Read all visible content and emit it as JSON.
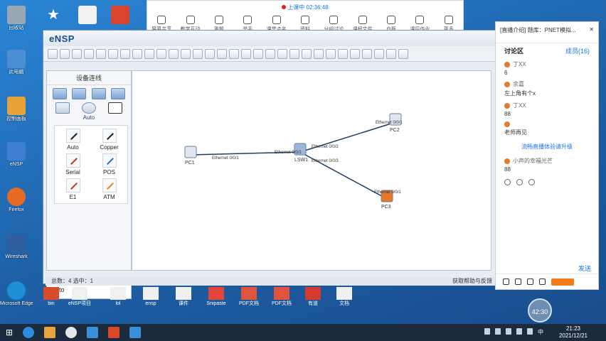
{
  "desktop": {
    "left_icons": [
      {
        "label": "回收站",
        "color": "#9aa7b5"
      },
      {
        "label": "此电脑",
        "color": "#4a8fd4"
      },
      {
        "label": "控制面板",
        "color": "#e5a33a"
      },
      {
        "label": "eNSP",
        "color": "#3e7fd1"
      },
      {
        "label": "Firefox",
        "color": "#e66b22"
      },
      {
        "label": "Wireshark",
        "color": "#2e5f9e"
      },
      {
        "label": "Microsoft Edge",
        "color": "#1e8fd6"
      }
    ],
    "bottom_icons": [
      {
        "label": "bin",
        "color": "#d94a2a"
      },
      {
        "label": "eNSP项目",
        "color": "#f0f0f0"
      },
      {
        "label": "lol",
        "color": "#f0f0f0"
      },
      {
        "label": "ensp",
        "color": "#f0f0f0"
      },
      {
        "label": "课件",
        "color": "#f0f0f0"
      },
      {
        "label": "Snipaste",
        "color": "#e2453b"
      },
      {
        "label": "PDF文档",
        "color": "#e0533c"
      },
      {
        "label": "PDF文档",
        "color": "#e0533c"
      },
      {
        "label": "有道",
        "color": "#d43a30"
      },
      {
        "label": "文档",
        "color": "#f0f0f0"
      }
    ]
  },
  "classbar": {
    "status": "上课中 02:36:48",
    "tools": [
      "屏幕共享",
      "教学互动",
      "答题",
      "举手",
      "课堂点名",
      "资料",
      "分组讨论",
      "课程文件",
      "白板",
      "课后作业",
      "更多"
    ]
  },
  "ensp": {
    "title": "eNSP",
    "sidebar_title": "设备连线",
    "selected_device": "Auto",
    "cables": [
      {
        "label": "Auto",
        "color": "#222222"
      },
      {
        "label": "Copper",
        "color": "#222222"
      },
      {
        "label": "Serial",
        "color": "#c0392b"
      },
      {
        "label": "POS",
        "color": "#2b6cd4"
      },
      {
        "label": "E1",
        "color": "#c0392b"
      },
      {
        "label": "ATM",
        "color": "#d98a1e"
      }
    ],
    "sidebar_bottom": "Auto",
    "status_left": "总数：4 选中：1",
    "status_right": "获取帮助与反馈",
    "topology": {
      "nodes": [
        {
          "id": "PC1",
          "label": "PC1"
        },
        {
          "id": "LSW1",
          "label": "LSW1"
        },
        {
          "id": "PC2",
          "label": "PC2"
        },
        {
          "id": "PC3",
          "label": "PC3"
        }
      ],
      "ports": [
        "Ethernet 0/0/1",
        "Ethernet 0/0/1",
        "Ethernet 0/0/2",
        "Ethernet 0/0/3",
        "Ethernet 0/0/1",
        "Ethernet 0/0/1"
      ]
    }
  },
  "discussion": {
    "header": "[直播介绍] 题库：PNET模拟...",
    "tab": "讨论区",
    "member_count": "成员(16)",
    "messages": [
      {
        "name": "丁XX",
        "text": "6"
      },
      {
        "name": "余嘉",
        "text": "左上角有个x"
      },
      {
        "name": "丁XX",
        "text": "88"
      },
      {
        "name": "",
        "text": "老师再见"
      }
    ],
    "notice": "流畅直播体验请升级",
    "last_user": "小声的幸福光芒",
    "last_text": "88",
    "send_label": "发送",
    "timer": "42:30"
  },
  "taskbar": {
    "ime": "中",
    "time": "21:23",
    "date": "2021/12/21"
  }
}
